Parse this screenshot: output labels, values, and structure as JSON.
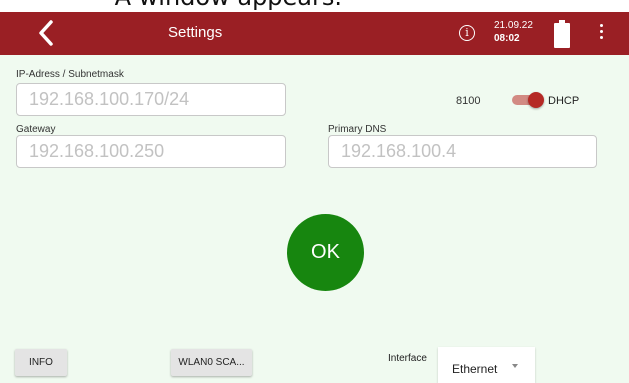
{
  "caption": "– A window appears.",
  "header": {
    "title": "Settings",
    "date": "21.09.22",
    "time": "08:02",
    "accent": "#9a1f24",
    "icons": [
      "back-arrow-icon",
      "info-icon",
      "battery-icon",
      "more-vert-icon"
    ]
  },
  "form": {
    "ip": {
      "label": "IP-Adress / Subnetmask",
      "placeholder": "192.168.100.170/24"
    },
    "dhcp": {
      "value": "8100",
      "label": "DHCP",
      "enabled": true
    },
    "gateway": {
      "label": "Gateway",
      "placeholder": "192.168.100.250"
    },
    "dns": {
      "label": "Primary DNS",
      "placeholder": "192.168.100.4"
    }
  },
  "ok_label": "OK",
  "footer": {
    "info_label": "INFO",
    "wlan_label": "WLAN0 SCA...",
    "interface_label": "Interface",
    "interface_value": "Ethernet"
  },
  "colors": {
    "header": "#9a1f24",
    "background": "#f0faf0",
    "ok": "#17860f",
    "toggle": "#b52925"
  }
}
